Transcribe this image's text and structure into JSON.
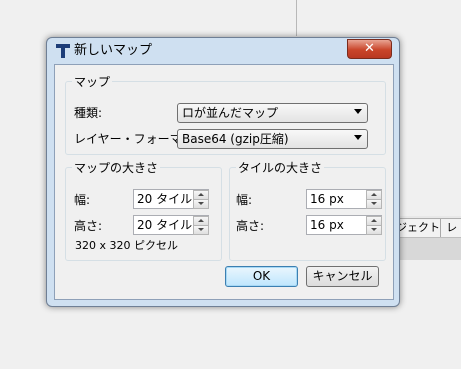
{
  "background": {
    "tabs": [
      "ジェクト",
      "レ"
    ]
  },
  "dialog": {
    "title": "新しいマップ",
    "close_glyph": "✕",
    "map_group": {
      "legend": "マップ",
      "type_label": "種類:",
      "type_value": "ロが並んだマップ",
      "format_label": "レイヤー・フォーマット:",
      "format_value": "Base64 (gzip圧縮)"
    },
    "map_size_group": {
      "legend": "マップの大きさ",
      "width_label": "幅:",
      "width_value": "20 タイル",
      "height_label": "高さ:",
      "height_value": "20 タイル",
      "pixel_info": "320 x 320 ピクセル"
    },
    "tile_size_group": {
      "legend": "タイルの大きさ",
      "width_label": "幅:",
      "width_value": "16 px",
      "height_label": "高さ:",
      "height_value": "16 px"
    },
    "buttons": {
      "ok": "OK",
      "cancel": "キャンセル"
    }
  }
}
